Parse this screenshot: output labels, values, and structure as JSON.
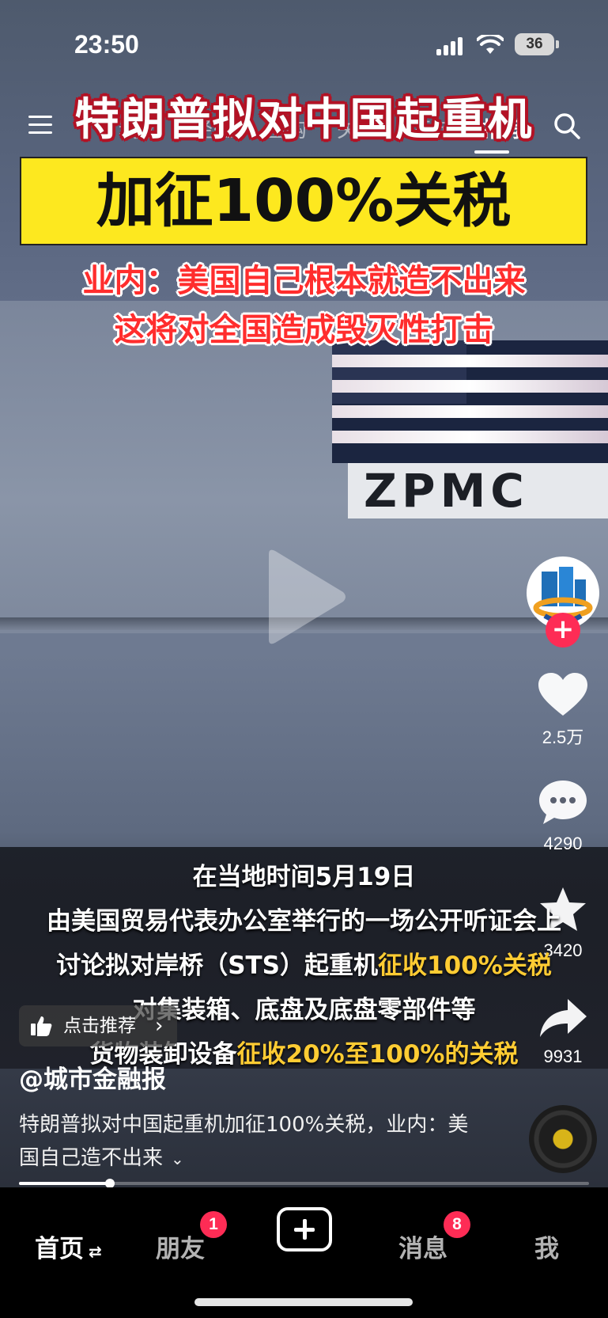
{
  "status_bar": {
    "time": "23:50",
    "battery": "36"
  },
  "top_nav": {
    "tabs": [
      "精选",
      "经验",
      "团购",
      "关注",
      "商城",
      "推荐"
    ],
    "active_tab": "推荐"
  },
  "video": {
    "headline_line1": "特朗普拟对中国起重机",
    "headline_line2": "加征100%关税",
    "headline_line3": "业内：美国自己根本就造不出来",
    "headline_line4": "这将对全国造成毁灭性打击",
    "sign_text": "ZPMC",
    "subtitles": [
      {
        "pre": "在当地时间5月19日",
        "hl": "",
        "post": ""
      },
      {
        "pre": "由美国贸易代表办公室举行的一场公开听证会上",
        "hl": "",
        "post": ""
      },
      {
        "pre": "讨论拟对岸桥（STS）起重机",
        "hl": "征收100%关税",
        "post": ""
      },
      {
        "pre": "对集装箱、底盘及底盘零部件等",
        "hl": "",
        "post": ""
      },
      {
        "pre": "货物装卸设备",
        "hl": "征收20%至100%的关税",
        "post": ""
      }
    ]
  },
  "right_rail": {
    "likes": "2.5万",
    "comments": "4290",
    "favorites": "3420",
    "shares": "9931"
  },
  "recommend_label": "点击推荐",
  "author": "@城市金融报",
  "description": "特朗普拟对中国起重机加征100%关税，业内：美国自己造不出来",
  "progress": 0.16,
  "bottom_nav": {
    "home": "首页",
    "friends": "朋友",
    "friends_badge": "1",
    "messages": "消息",
    "messages_badge": "8",
    "me": "我"
  },
  "colors": {
    "accent": "#fe2c55",
    "subtitle_highlight": "#ffcc33",
    "headline_box": "#fde81f"
  }
}
